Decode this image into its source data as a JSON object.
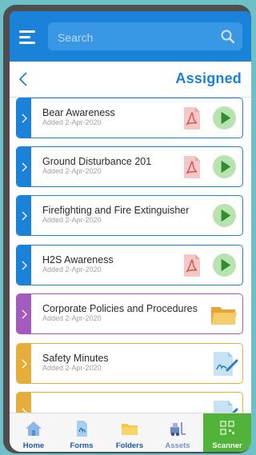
{
  "search": {
    "placeholder": "Search"
  },
  "header": {
    "title": "Assigned"
  },
  "items": [
    {
      "title": "Bear Awareness",
      "added": "Added 2-Apr-2020",
      "color": "#1a82d8",
      "has_pdf": true,
      "action": "play"
    },
    {
      "title": "Ground Disturbance 201",
      "added": "Added 2-Apr-2020",
      "color": "#1a82d8",
      "has_pdf": true,
      "action": "play"
    },
    {
      "title": "Firefighting and Fire Extinguisher",
      "added": "Added 2-Apr-2020",
      "color": "#1a82d8",
      "has_pdf": false,
      "action": "play"
    },
    {
      "title": "H2S Awareness",
      "added": "Added 2-Apr-2020",
      "color": "#1a82d8",
      "has_pdf": true,
      "action": "play"
    },
    {
      "title": "Corporate Policies and Procedures",
      "added": "Added 2-Apr-2020",
      "color": "#a55bbd",
      "has_pdf": false,
      "action": "folder"
    },
    {
      "title": "Safety Minutes",
      "added": "Added 2-Apr-2020",
      "color": "#e5ae3a",
      "has_pdf": false,
      "action": "sign"
    },
    {
      "title": "",
      "added": "",
      "color": "#e5ae3a",
      "has_pdf": false,
      "action": "sign"
    }
  ],
  "nav": [
    {
      "label": "Home",
      "icon": "home-icon"
    },
    {
      "label": "Forms",
      "icon": "forms-icon"
    },
    {
      "label": "Folders",
      "icon": "folder-icon"
    },
    {
      "label": "Assets",
      "icon": "assets-icon"
    },
    {
      "label": "Scanner",
      "icon": "qr-code-icon"
    }
  ],
  "colors": {
    "primary": "#1a82d8",
    "play_green": "#3aa33a",
    "pdf_red": "#d85450",
    "scanner_green": "#52b33a"
  }
}
